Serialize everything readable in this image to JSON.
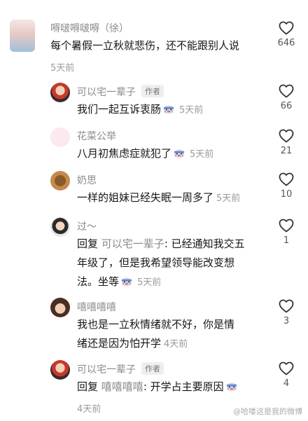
{
  "comments": [
    {
      "name": "嘚啵嘚啵嘚（徐）",
      "text": "每个暑假一立秋就悲伤，还不能跟别人说",
      "time": "5天前",
      "likes": "646"
    },
    {
      "name": "可以宅一辈子",
      "tag": "作者",
      "text": "我们一起互诉衷肠",
      "time": "5天前",
      "likes": "66"
    },
    {
      "name": "花菜公举",
      "text": "八月初焦虑症就犯了",
      "time": "5天前",
      "likes": "21"
    },
    {
      "name": "奶思",
      "text": "一样的姐妹已经失眠一周多了",
      "time": "5天前",
      "likes": "10"
    },
    {
      "name": "过～",
      "reply_prefix": "回复",
      "reply_to": "可以宅一辈子",
      "line1": ": 已经通知我交五",
      "line2": "年级了，但是我希望领导能改变想",
      "line3": "法。坐等",
      "time": "5天前",
      "likes": "1"
    },
    {
      "name": "嘻嘻嘻嘻",
      "line1": "我也是一立秋情绪就不好，你是情",
      "line2": "绪还是因为怕开学",
      "time": "4天前",
      "likes": "3"
    },
    {
      "name": "可以宅一辈子",
      "tag": "作者",
      "reply_prefix": "回复",
      "reply_to": "嘻嘻嘻嘻",
      "text": ": 开学占主要原因",
      "time": "4天前",
      "likes": "4"
    }
  ],
  "watermark": "@哈喽这是我的微博",
  "colors": {
    "accent_gray": "#8a8a8a",
    "text": "#161616"
  },
  "icons": [
    "heart-outline-icon",
    "cry-emoji-icon"
  ]
}
